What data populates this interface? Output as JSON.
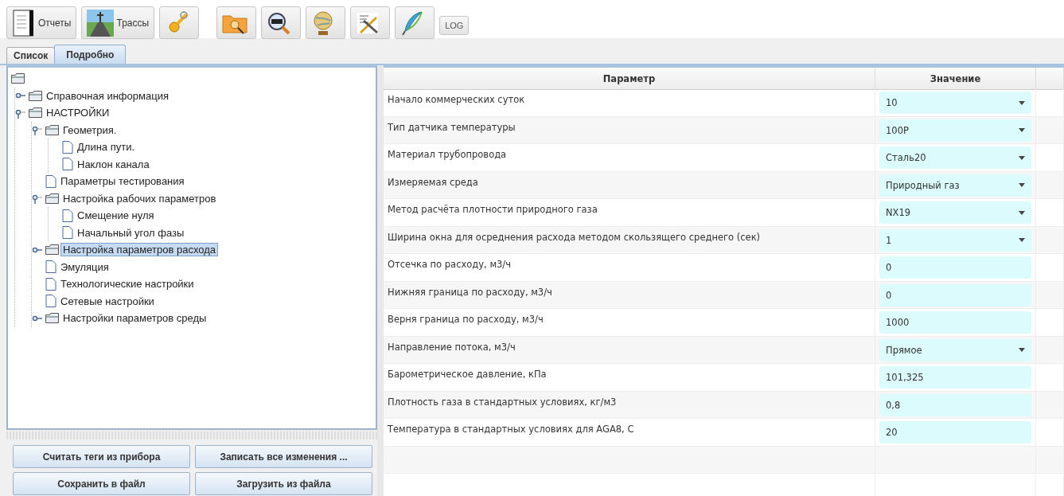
{
  "toolbar": {
    "groups": [
      {
        "items": [
          {
            "kind": "icon-text",
            "label": "Отчеты"
          },
          {
            "kind": "icon-text",
            "label": "Трассы"
          },
          {
            "kind": "icon"
          }
        ]
      },
      {
        "items": [
          {
            "kind": "icon"
          },
          {
            "kind": "icon"
          },
          {
            "kind": "icon"
          },
          {
            "kind": "icon"
          },
          {
            "kind": "icon"
          },
          {
            "kind": "text",
            "label": "LOG"
          }
        ]
      }
    ]
  },
  "tabs": [
    {
      "label": "Список",
      "selected": false
    },
    {
      "label": "Подробно",
      "selected": true
    }
  ],
  "tree": {
    "kind": "folder",
    "children": [
      {
        "label": "Справочная информация",
        "kind": "folder",
        "expanded": false,
        "selected": false
      },
      {
        "label": "НАСТРОЙКИ",
        "kind": "folder",
        "expanded": true,
        "selected": false,
        "children": [
          {
            "label": "Геометрия.",
            "kind": "folder",
            "expanded": true,
            "selected": false,
            "children": [
              {
                "label": "Длина пути.",
                "kind": "file",
                "selected": false
              },
              {
                "label": "Наклон канала",
                "kind": "file",
                "selected": false
              }
            ]
          },
          {
            "label": "Параметры тестирования",
            "kind": "file",
            "selected": false
          },
          {
            "label": "Настройка рабочих параметров",
            "kind": "folder",
            "expanded": true,
            "selected": false,
            "children": [
              {
                "label": "Смещение нуля",
                "kind": "file",
                "selected": false
              },
              {
                "label": "Начальный угол фазы",
                "kind": "file",
                "selected": false
              }
            ]
          },
          {
            "label": "Настройка параметров расхода",
            "kind": "folder",
            "expanded": false,
            "selected": true
          },
          {
            "label": "Эмуляция",
            "kind": "file",
            "selected": false
          },
          {
            "label": "Технологические настройки",
            "kind": "file",
            "selected": false
          },
          {
            "label": "Сетевые настройки",
            "kind": "file",
            "selected": false
          },
          {
            "label": "Настройки параметров среды",
            "kind": "folder",
            "expanded": false,
            "selected": false
          }
        ]
      }
    ]
  },
  "actions": [
    "Считать теги из прибора",
    "Записать все изменения ...",
    "Сохранить в файл",
    "Загрузить из файла"
  ],
  "table": {
    "columns": [
      "Параметр",
      "Значение"
    ],
    "rows": [
      {
        "name": "Начало коммерческих суток",
        "value": "10",
        "kind": "dropdown"
      },
      {
        "name": "Тип датчика температуры",
        "value": "100P",
        "kind": "dropdown"
      },
      {
        "name": "Материал трубопровода",
        "value": "Сталь20",
        "kind": "dropdown"
      },
      {
        "name": "Измеряемая среда",
        "value": "Природный газ",
        "kind": "dropdown"
      },
      {
        "name": "Метод расчёта плотности природного газа",
        "value": "NX19",
        "kind": "dropdown"
      },
      {
        "name": "Ширина окна для осреднения расхода методом скользящего среднего (сек)",
        "value": "1",
        "kind": "dropdown"
      },
      {
        "name": "Отсечка по расходу, м3/ч",
        "value": "0",
        "kind": "field"
      },
      {
        "name": "Нижняя граница по расходу, м3/ч",
        "value": "0",
        "kind": "field"
      },
      {
        "name": "Верня граница по расходу, м3/ч",
        "value": "1000",
        "kind": "field"
      },
      {
        "name": "Направление потока, м3/ч",
        "value": "Прямое",
        "kind": "dropdown"
      },
      {
        "name": "Барометрическое давление, кПа",
        "value": "101,325",
        "kind": "field"
      },
      {
        "name": "Плотность газа в стандартных условиях, кг/м3",
        "value": "0,8",
        "kind": "field"
      },
      {
        "name": "Температура в стандартных условиях для AGA8, С",
        "value": "20",
        "kind": "field"
      }
    ]
  }
}
